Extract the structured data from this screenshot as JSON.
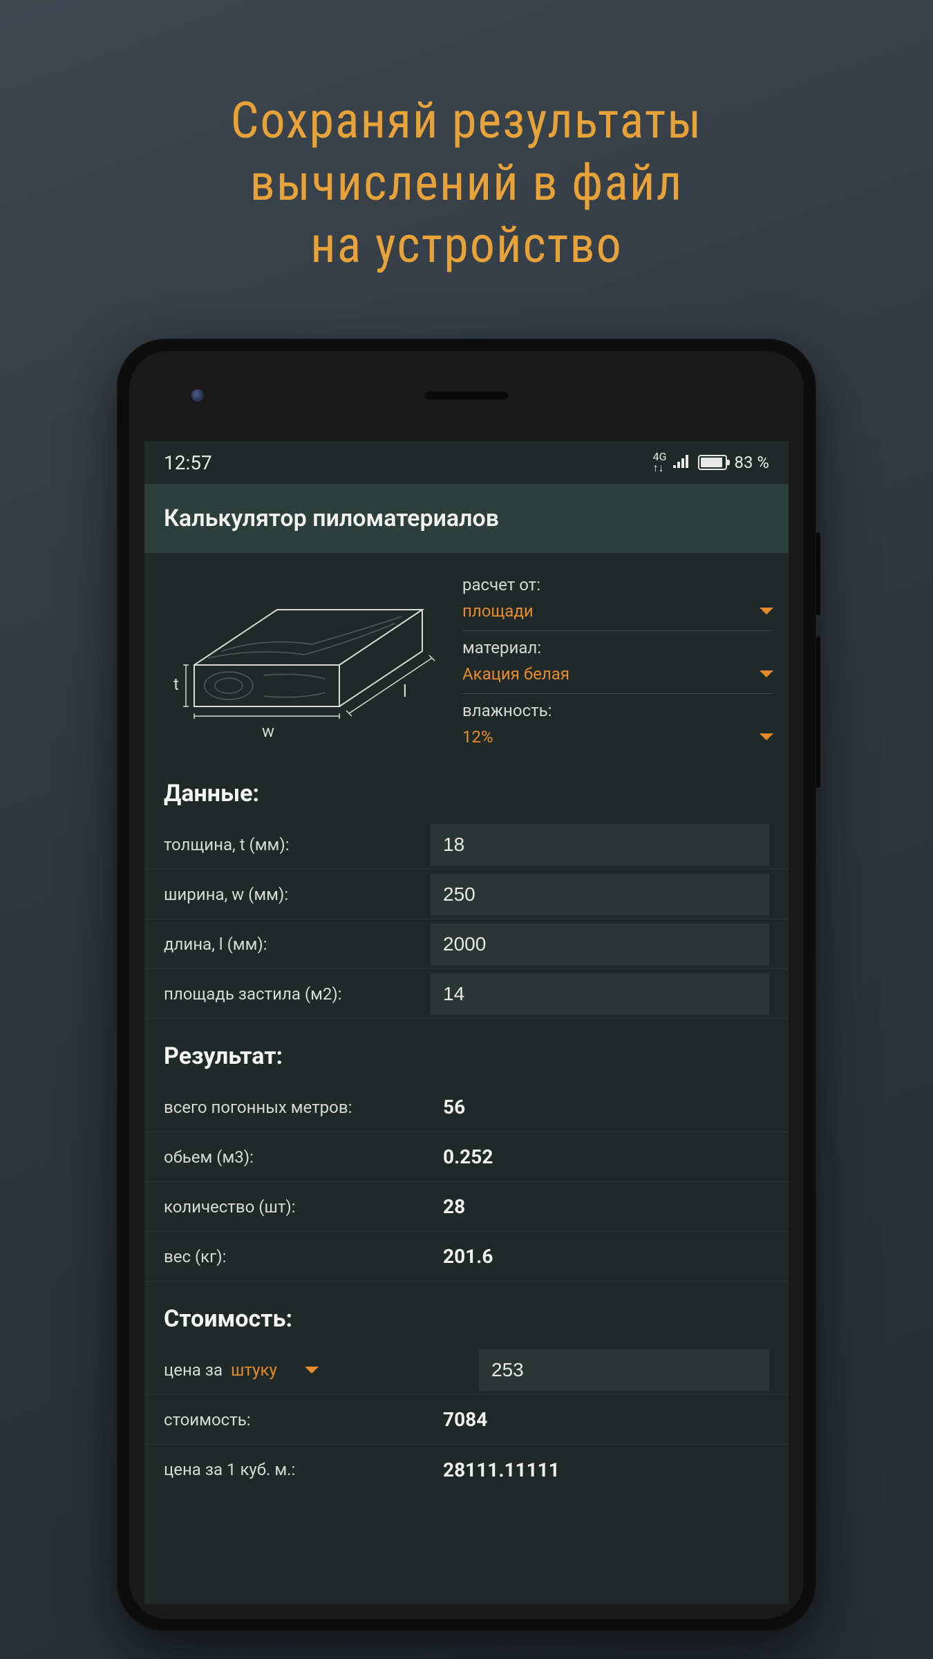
{
  "promo": {
    "line1": "Сохраняй результаты",
    "line2": "вычислений в файл",
    "line3": "на устройство"
  },
  "status": {
    "time": "12:57",
    "network": "4G",
    "battery": "83 %"
  },
  "app": {
    "title": "Калькулятор пиломатериалов"
  },
  "dropdowns": {
    "calc_from_label": "расчет от:",
    "calc_from_value": "площади",
    "material_label": "материал:",
    "material_value": "Акация белая",
    "humidity_label": "влажность:",
    "humidity_value": "12%"
  },
  "diagram": {
    "t_label": "t",
    "w_label": "w",
    "l_label": "l"
  },
  "sections": {
    "data": "Данные:",
    "result": "Результат:",
    "cost": "Стоимость:"
  },
  "data_rows": {
    "thickness_label": "толщина, t (мм):",
    "thickness_value": "18",
    "width_label": "ширина, w (мм):",
    "width_value": "250",
    "length_label": "длина, l (мм):",
    "length_value": "2000",
    "area_label": "площадь застила (м2):",
    "area_value": "14"
  },
  "result_rows": {
    "linear_label": "всего погонных метров:",
    "linear_value": "56",
    "volume_label": "обьем (м3):",
    "volume_value": "0.252",
    "count_label": "количество (шт):",
    "count_value": "28",
    "weight_label": "вес (кг):",
    "weight_value": "201.6"
  },
  "cost_rows": {
    "price_per_label": "цена за",
    "price_per_unit": "штуку",
    "price_value": "253",
    "total_label": "стоимость:",
    "total_value": "7084",
    "per_cube_label": "цена за 1 куб. м.:",
    "per_cube_value": "28111.11111"
  }
}
